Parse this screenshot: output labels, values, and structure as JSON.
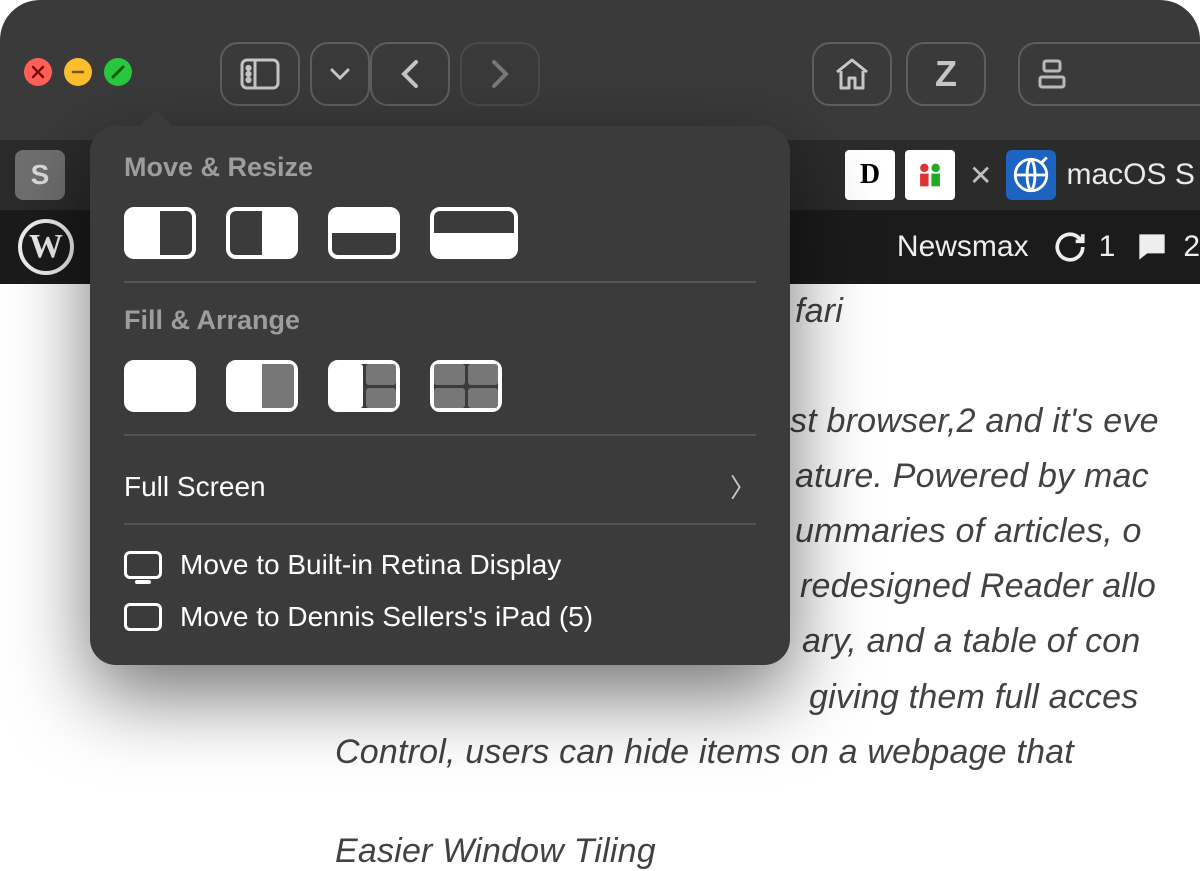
{
  "popover": {
    "heading_move": "Move & Resize",
    "heading_fill": "Fill & Arrange",
    "full_screen": "Full Screen",
    "move_builtin": "Move to Built-in Retina Display",
    "move_ipad": "Move to Dennis Sellers's iPad (5)"
  },
  "favstrip": {
    "tab_macos": "macOS S"
  },
  "wpbar": {
    "site": "Newsmax",
    "refresh_count": "1",
    "comment_count": "2"
  },
  "page": {
    "l0": "fari",
    "l1": "st browser,2 and it's eve",
    "l2": "ature. Powered by mac",
    "l3": "ummaries of articles, o",
    "l4": "redesigned Reader allo",
    "l5": "ary, and a table of con",
    "l6": "giving them full acces",
    "l7": "Control, users can hide items on a webpage that",
    "sub": "Easier Window Tiling"
  }
}
